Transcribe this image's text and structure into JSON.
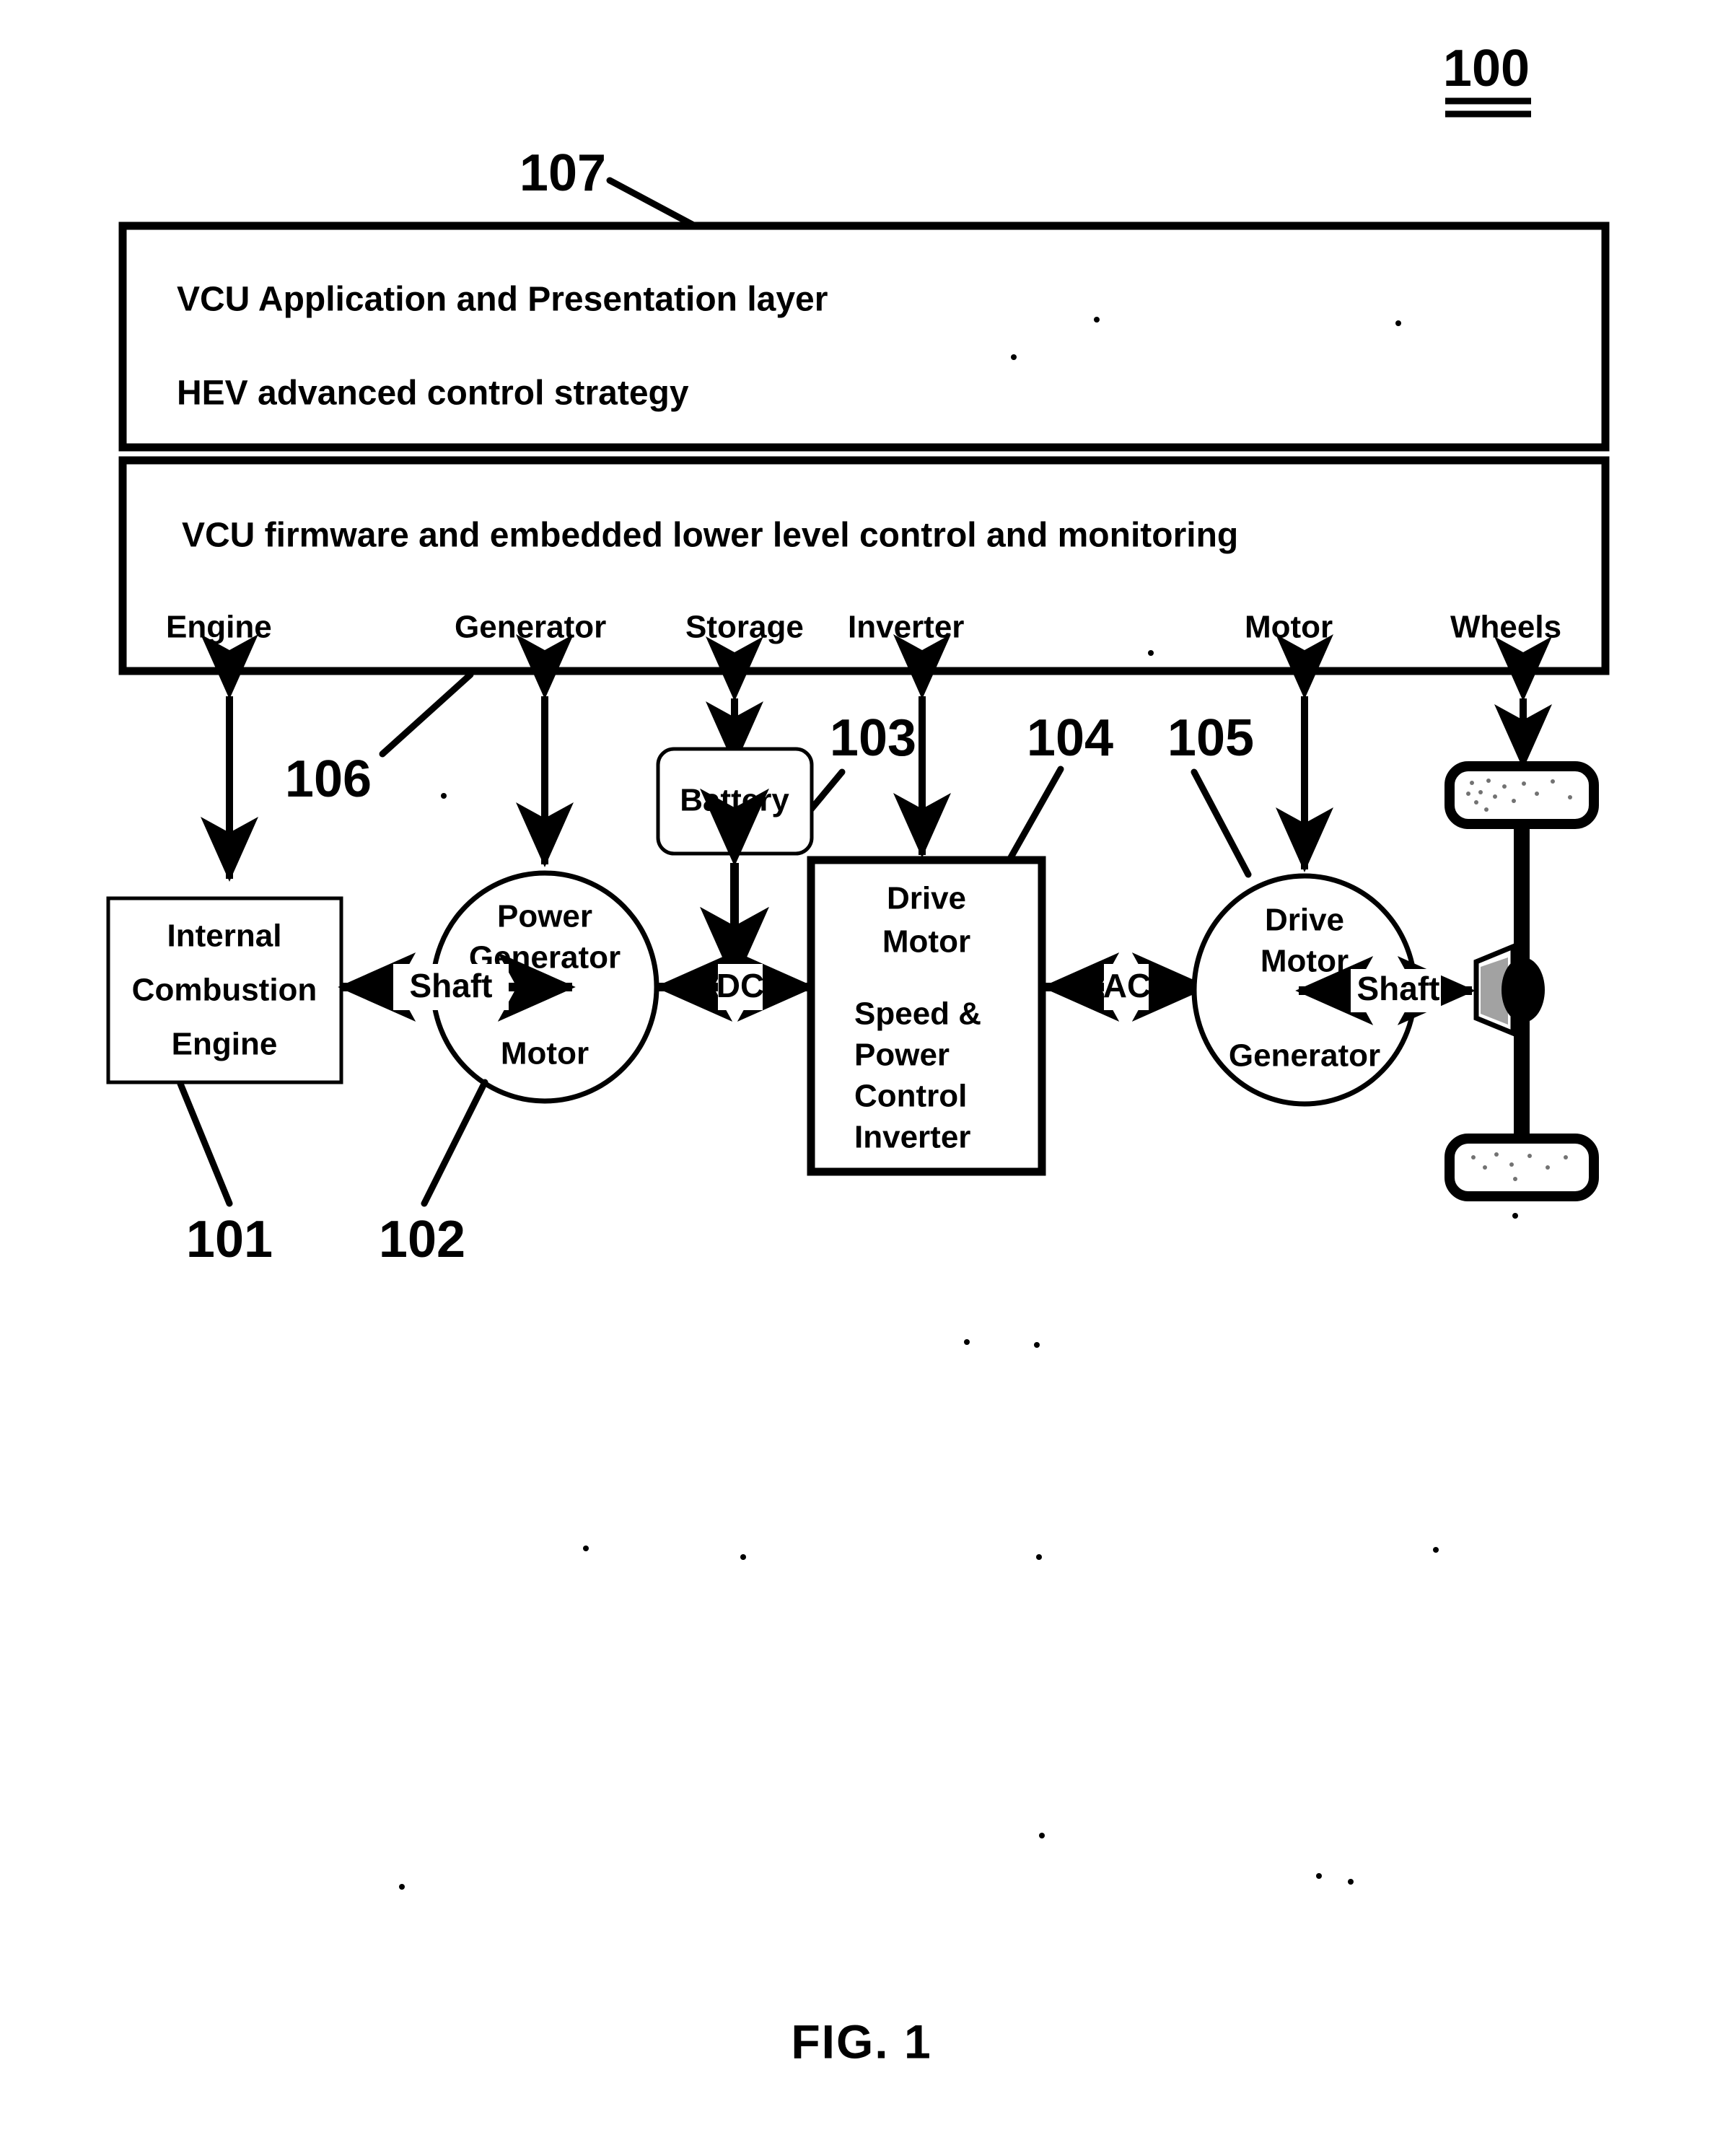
{
  "figure": {
    "caption": "FIG. 1",
    "system_ref": "100"
  },
  "reference_numerals": {
    "ice": "101",
    "power_generator_motor": "102",
    "battery": "103",
    "inverter": "104",
    "drive_motor_generator": "105",
    "vcu_firmware": "106",
    "vcu_application": "107"
  },
  "layers": {
    "application": {
      "line1": "VCU Application and Presentation layer",
      "line2": "HEV advanced control strategy"
    },
    "firmware": {
      "title": "VCU firmware and embedded lower level control and monitoring",
      "ports": [
        {
          "label": "Engine"
        },
        {
          "label": "Generator"
        },
        {
          "label": "Storage"
        },
        {
          "label": "Inverter"
        },
        {
          "label": "Motor"
        },
        {
          "label": "Wheels"
        }
      ]
    }
  },
  "components": {
    "ice": {
      "line1": "Internal",
      "line2": "Combustion",
      "line3": "Engine"
    },
    "power_generator_motor": {
      "line1": "Power",
      "line2": "Generator",
      "line3": "Motor"
    },
    "battery": {
      "label": "Battery"
    },
    "inverter": {
      "line1": "Drive",
      "line2": "Motor",
      "line3": "Speed &",
      "line4": "Power",
      "line5": "Control",
      "line6": "Inverter"
    },
    "drive_motor_generator": {
      "line1": "Drive",
      "line2": "Motor",
      "line3": "Generator"
    },
    "wheels": {
      "top_label": "",
      "bottom_label": ""
    }
  },
  "connections": {
    "ice_to_generator": "Shaft",
    "generator_to_inverter": "DC",
    "inverter_to_motor": "AC",
    "motor_to_wheels": "Shaft"
  },
  "colors": {
    "ink": "#000000",
    "paper": "#ffffff"
  }
}
